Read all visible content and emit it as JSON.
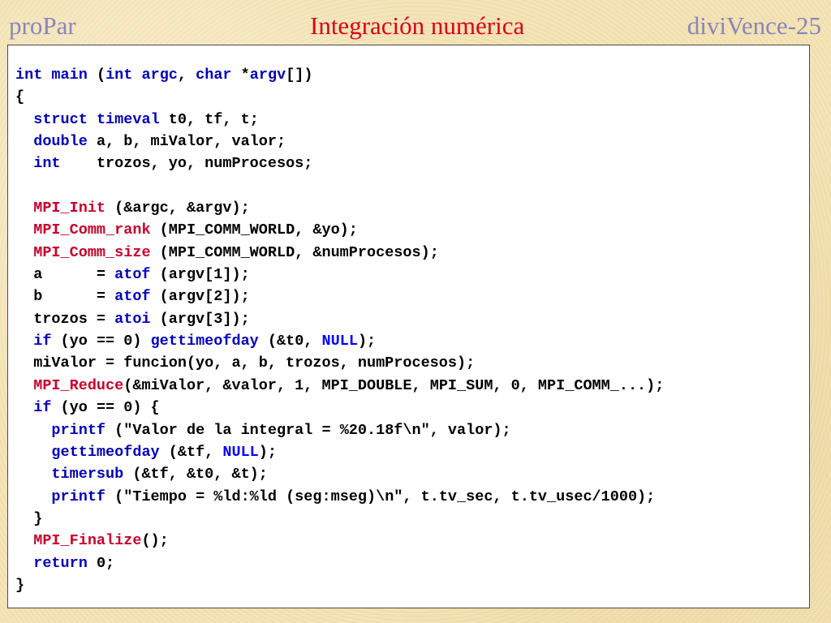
{
  "header": {
    "left": "proPar",
    "center": "Integración numérica",
    "right": "diviVence-25"
  },
  "colors": {
    "background": "#f3e3b3",
    "header_side": "#8a85ba",
    "header_title": "#d9001b",
    "keyword": "#0000b8",
    "mpi_function": "#c4002b",
    "constant": "#0000ff",
    "text": "#000000"
  },
  "code": {
    "language": "C",
    "lines": [
      [
        [
          "kw",
          "int"
        ],
        [
          "tx",
          " "
        ],
        [
          "kw",
          "main"
        ],
        [
          "tx",
          " ("
        ],
        [
          "kw",
          "int"
        ],
        [
          "tx",
          " "
        ],
        [
          "kw",
          "argc"
        ],
        [
          "tx",
          ", "
        ],
        [
          "kw",
          "char"
        ],
        [
          "tx",
          " *"
        ],
        [
          "kw",
          "argv"
        ],
        [
          "tx",
          "[])"
        ]
      ],
      [
        [
          "tx",
          "{"
        ]
      ],
      [
        [
          "tx",
          "  "
        ],
        [
          "kw",
          "struct"
        ],
        [
          "tx",
          " "
        ],
        [
          "kw",
          "timeval"
        ],
        [
          "tx",
          " t0, tf, t;"
        ]
      ],
      [
        [
          "tx",
          "  "
        ],
        [
          "kw",
          "double"
        ],
        [
          "tx",
          " a, b, miValor, valor;"
        ]
      ],
      [
        [
          "tx",
          "  "
        ],
        [
          "kw",
          "int"
        ],
        [
          "tx",
          "    trozos, yo, numProcesos;"
        ]
      ],
      [
        [
          "tx",
          ""
        ]
      ],
      [
        [
          "tx",
          "  "
        ],
        [
          "fn",
          "MPI_Init"
        ],
        [
          "tx",
          " (&argc, &argv);"
        ]
      ],
      [
        [
          "tx",
          "  "
        ],
        [
          "fn",
          "MPI_Comm_rank"
        ],
        [
          "tx",
          " (MPI_COMM_WORLD, &yo);"
        ]
      ],
      [
        [
          "tx",
          "  "
        ],
        [
          "fn",
          "MPI_Comm_size"
        ],
        [
          "tx",
          " (MPI_COMM_WORLD, &numProcesos);"
        ]
      ],
      [
        [
          "tx",
          "  a      = "
        ],
        [
          "kw",
          "atof"
        ],
        [
          "tx",
          " (argv[1]);"
        ]
      ],
      [
        [
          "tx",
          "  b      = "
        ],
        [
          "kw",
          "atof"
        ],
        [
          "tx",
          " (argv[2]);"
        ]
      ],
      [
        [
          "tx",
          "  trozos = "
        ],
        [
          "kw",
          "atoi"
        ],
        [
          "tx",
          " (argv[3]);"
        ]
      ],
      [
        [
          "tx",
          "  "
        ],
        [
          "kw",
          "if"
        ],
        [
          "tx",
          " (yo == 0) "
        ],
        [
          "kw",
          "gettimeofday"
        ],
        [
          "tx",
          " (&t0, "
        ],
        [
          "cn",
          "NULL"
        ],
        [
          "tx",
          ");"
        ]
      ],
      [
        [
          "tx",
          "  miValor = funcion(yo, a, b, trozos, numProcesos);"
        ]
      ],
      [
        [
          "tx",
          "  "
        ],
        [
          "fn",
          "MPI_Reduce"
        ],
        [
          "tx",
          "(&miValor, &valor, 1, MPI_DOUBLE, MPI_SUM, 0, MPI_COMM_...);"
        ]
      ],
      [
        [
          "tx",
          "  "
        ],
        [
          "kw",
          "if"
        ],
        [
          "tx",
          " (yo == 0) {"
        ]
      ],
      [
        [
          "tx",
          "    "
        ],
        [
          "kw",
          "printf"
        ],
        [
          "tx",
          " (\"Valor de la integral = %20.18f\\n\", valor);"
        ]
      ],
      [
        [
          "tx",
          "    "
        ],
        [
          "kw",
          "gettimeofday"
        ],
        [
          "tx",
          " (&tf, "
        ],
        [
          "cn",
          "NULL"
        ],
        [
          "tx",
          ");"
        ]
      ],
      [
        [
          "tx",
          "    "
        ],
        [
          "kw",
          "timersub"
        ],
        [
          "tx",
          " (&tf, &t0, &t);"
        ]
      ],
      [
        [
          "tx",
          "    "
        ],
        [
          "kw",
          "printf"
        ],
        [
          "tx",
          " (\"Tiempo = %ld:%ld (seg:mseg)\\n\", t.tv_sec, t.tv_usec/1000);"
        ]
      ],
      [
        [
          "tx",
          "  }"
        ]
      ],
      [
        [
          "tx",
          "  "
        ],
        [
          "fn",
          "MPI_Finalize"
        ],
        [
          "tx",
          "();"
        ]
      ],
      [
        [
          "tx",
          "  "
        ],
        [
          "kw",
          "return"
        ],
        [
          "tx",
          " 0;"
        ]
      ],
      [
        [
          "tx",
          "}"
        ]
      ]
    ]
  }
}
